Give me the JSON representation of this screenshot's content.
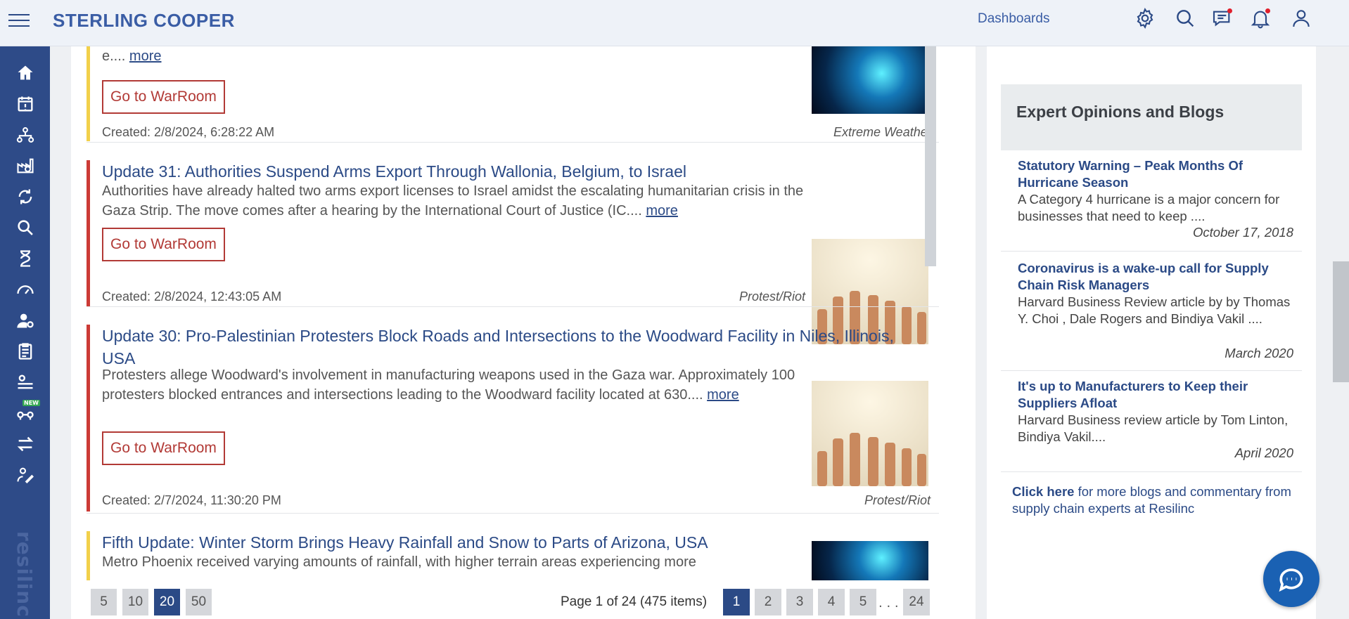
{
  "header": {
    "brand": "STERLING COOPER",
    "dashboards_label": "Dashboards"
  },
  "sidebar": {
    "items": [
      "home-icon",
      "calendar-alert-icon",
      "network-icon",
      "factory-icon",
      "refresh-cycle-icon",
      "risk-search-icon",
      "hourglass-icon",
      "gauge-icon",
      "user-settings-icon",
      "clipboard-icon",
      "supplier-mapping-icon",
      "new-feature-icon",
      "transfer-icon",
      "tools-icon"
    ],
    "new_badge": "NEW",
    "logo_text": "resilinc"
  },
  "feed": {
    "cards": [
      {
        "title": "",
        "desc_tail": "e....",
        "more": "more",
        "button": "Go to WarRoom",
        "created": "Created: 2/8/2024, 6:28:22 AM",
        "category": "Extreme Weather",
        "bar_color": "#f2d04a"
      },
      {
        "title": "Update 31: Authorities Suspend Arms Export Through Wallonia, Belgium, to Israel",
        "desc": "Authorities have already halted two arms export licenses to Israel amidst the escalating humanitarian crisis in the Gaza Strip. The move comes after a hearing by the International Court of Justice (IC....",
        "more": "more",
        "button": "Go to WarRoom",
        "created": "Created: 2/8/2024, 12:43:05 AM",
        "category": "Protest/Riot",
        "bar_color": "#cc3b36"
      },
      {
        "title": "Update 30: Pro-Palestinian Protesters Block Roads and Intersections to the Woodward Facility in Niles, Illinois, USA",
        "desc": "Protesters allege Woodward's involvement in manufacturing weapons used in the Gaza war. Approximately 100 protesters blocked entrances and intersections leading to the Woodward facility located at 630....",
        "more": "more",
        "button": "Go to WarRoom",
        "created": "Created: 2/7/2024, 11:30:20 PM",
        "category": "Protest/Riot",
        "bar_color": "#cc3b36"
      },
      {
        "title": "Fifth Update: Winter Storm Brings Heavy Rainfall and Snow to Parts of Arizona, USA",
        "desc": "Metro Phoenix received varying amounts of rainfall, with higher terrain areas experiencing more",
        "bar_color": "#f2d04a"
      }
    ]
  },
  "pager": {
    "sizes": [
      "5",
      "10",
      "20",
      "50"
    ],
    "active_size": "20",
    "info": "Page 1 of 24 (475 items)",
    "pages": [
      "1",
      "2",
      "3",
      "4",
      "5"
    ],
    "ellipsis": ". . .",
    "last": "24",
    "active_page": "1"
  },
  "blogs": {
    "heading": "Expert Opinions and Blogs",
    "items": [
      {
        "title": "Statutory Warning – Peak Months Of Hurricane Season",
        "desc": "A Category 4 hurricane is a major concern for businesses that need to keep ....",
        "date": "October 17, 2018"
      },
      {
        "title": "Coronavirus is a wake-up call for Supply Chain Risk Managers",
        "desc": "Harvard Business Review article by by Thomas Y. Choi , Dale Rogers and Bindiya Vakil ....",
        "date": "March 2020"
      },
      {
        "title": "It's up to Manufacturers to Keep their Suppliers Afloat",
        "desc": "Harvard Business review article by Tom Linton, Bindiya Vakil....",
        "date": "April 2020"
      }
    ],
    "click_here": "Click here",
    "click_rest": " for more blogs and commentary from supply chain experts at Resilinc"
  },
  "colors": {
    "accent": "#2b4a86",
    "sidebar": "#2e4b88",
    "warroom": "#b23a36"
  }
}
